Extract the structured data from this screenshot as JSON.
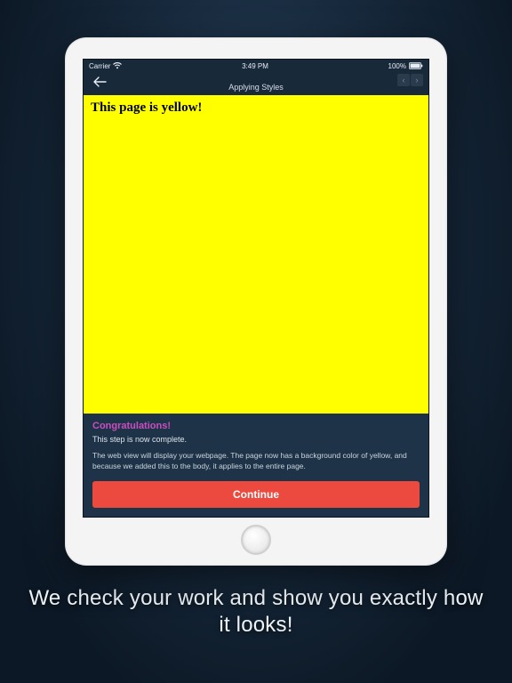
{
  "statusBar": {
    "carrier": "Carrier",
    "time": "3:49 PM",
    "battery": "100%"
  },
  "nav": {
    "title": "Applying Styles"
  },
  "preview": {
    "heading": "This page is yellow!"
  },
  "panel": {
    "congrats": "Congratulations!",
    "stepComplete": "This step is now complete.",
    "explanation": "The web view will display your webpage. The page now has a background color of yellow, and because we added this to the body, it applies to the entire page.",
    "continueLabel": "Continue"
  },
  "caption": "We check your work and show you exactly how it looks!"
}
